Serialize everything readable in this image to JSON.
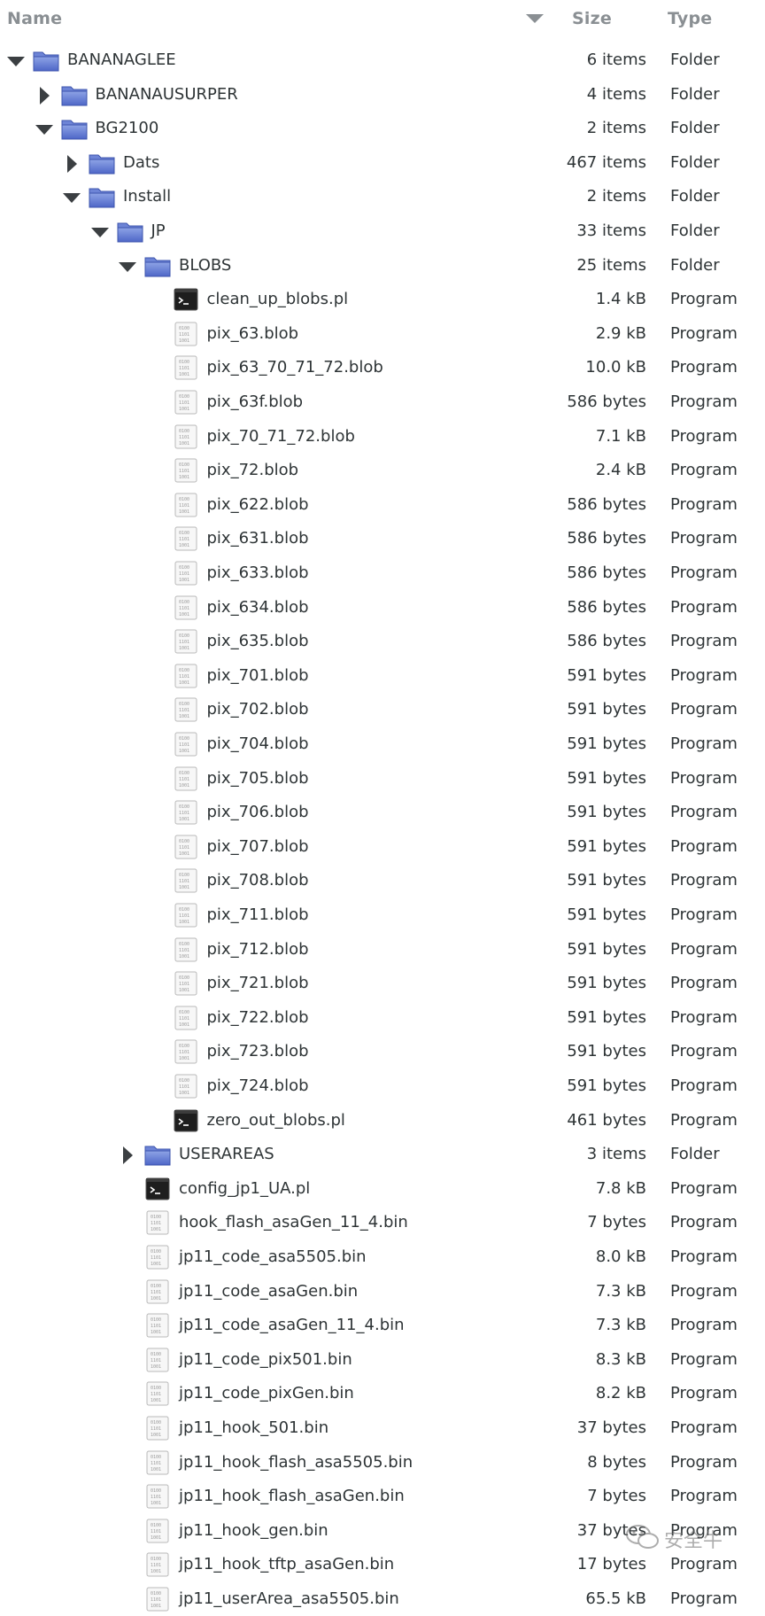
{
  "header": {
    "name_label": "Name",
    "size_label": "Size",
    "type_label": "Type",
    "sort_icon": "sort-descending-icon"
  },
  "rows": [
    {
      "name": "BANANAGLEE",
      "size": "6 items",
      "type": "Folder",
      "depth": 0,
      "kind": "folder",
      "expander": "open"
    },
    {
      "name": "BANANAUSURPER",
      "size": "4 items",
      "type": "Folder",
      "depth": 1,
      "kind": "folder",
      "expander": "closed"
    },
    {
      "name": "BG2100",
      "size": "2 items",
      "type": "Folder",
      "depth": 1,
      "kind": "folder",
      "expander": "open"
    },
    {
      "name": "Dats",
      "size": "467 items",
      "type": "Folder",
      "depth": 2,
      "kind": "folder",
      "expander": "closed"
    },
    {
      "name": "Install",
      "size": "2 items",
      "type": "Folder",
      "depth": 2,
      "kind": "folder",
      "expander": "open"
    },
    {
      "name": "JP",
      "size": "33 items",
      "type": "Folder",
      "depth": 3,
      "kind": "folder",
      "expander": "open"
    },
    {
      "name": "BLOBS",
      "size": "25 items",
      "type": "Folder",
      "depth": 4,
      "kind": "folder",
      "expander": "open"
    },
    {
      "name": "clean_up_blobs.pl",
      "size": "1.4 kB",
      "type": "Program",
      "depth": 5,
      "kind": "script"
    },
    {
      "name": "pix_63.blob",
      "size": "2.9 kB",
      "type": "Program",
      "depth": 5,
      "kind": "binary"
    },
    {
      "name": "pix_63_70_71_72.blob",
      "size": "10.0 kB",
      "type": "Program",
      "depth": 5,
      "kind": "binary"
    },
    {
      "name": "pix_63f.blob",
      "size": "586 bytes",
      "type": "Program",
      "depth": 5,
      "kind": "binary"
    },
    {
      "name": "pix_70_71_72.blob",
      "size": "7.1 kB",
      "type": "Program",
      "depth": 5,
      "kind": "binary"
    },
    {
      "name": "pix_72.blob",
      "size": "2.4 kB",
      "type": "Program",
      "depth": 5,
      "kind": "binary"
    },
    {
      "name": "pix_622.blob",
      "size": "586 bytes",
      "type": "Program",
      "depth": 5,
      "kind": "binary"
    },
    {
      "name": "pix_631.blob",
      "size": "586 bytes",
      "type": "Program",
      "depth": 5,
      "kind": "binary"
    },
    {
      "name": "pix_633.blob",
      "size": "586 bytes",
      "type": "Program",
      "depth": 5,
      "kind": "binary"
    },
    {
      "name": "pix_634.blob",
      "size": "586 bytes",
      "type": "Program",
      "depth": 5,
      "kind": "binary"
    },
    {
      "name": "pix_635.blob",
      "size": "586 bytes",
      "type": "Program",
      "depth": 5,
      "kind": "binary"
    },
    {
      "name": "pix_701.blob",
      "size": "591 bytes",
      "type": "Program",
      "depth": 5,
      "kind": "binary"
    },
    {
      "name": "pix_702.blob",
      "size": "591 bytes",
      "type": "Program",
      "depth": 5,
      "kind": "binary"
    },
    {
      "name": "pix_704.blob",
      "size": "591 bytes",
      "type": "Program",
      "depth": 5,
      "kind": "binary"
    },
    {
      "name": "pix_705.blob",
      "size": "591 bytes",
      "type": "Program",
      "depth": 5,
      "kind": "binary"
    },
    {
      "name": "pix_706.blob",
      "size": "591 bytes",
      "type": "Program",
      "depth": 5,
      "kind": "binary"
    },
    {
      "name": "pix_707.blob",
      "size": "591 bytes",
      "type": "Program",
      "depth": 5,
      "kind": "binary"
    },
    {
      "name": "pix_708.blob",
      "size": "591 bytes",
      "type": "Program",
      "depth": 5,
      "kind": "binary"
    },
    {
      "name": "pix_711.blob",
      "size": "591 bytes",
      "type": "Program",
      "depth": 5,
      "kind": "binary"
    },
    {
      "name": "pix_712.blob",
      "size": "591 bytes",
      "type": "Program",
      "depth": 5,
      "kind": "binary"
    },
    {
      "name": "pix_721.blob",
      "size": "591 bytes",
      "type": "Program",
      "depth": 5,
      "kind": "binary"
    },
    {
      "name": "pix_722.blob",
      "size": "591 bytes",
      "type": "Program",
      "depth": 5,
      "kind": "binary"
    },
    {
      "name": "pix_723.blob",
      "size": "591 bytes",
      "type": "Program",
      "depth": 5,
      "kind": "binary"
    },
    {
      "name": "pix_724.blob",
      "size": "591 bytes",
      "type": "Program",
      "depth": 5,
      "kind": "binary"
    },
    {
      "name": "zero_out_blobs.pl",
      "size": "461 bytes",
      "type": "Program",
      "depth": 5,
      "kind": "script"
    },
    {
      "name": "USERAREAS",
      "size": "3 items",
      "type": "Folder",
      "depth": 4,
      "kind": "folder",
      "expander": "closed"
    },
    {
      "name": "config_jp1_UA.pl",
      "size": "7.8 kB",
      "type": "Program",
      "depth": 4,
      "kind": "script"
    },
    {
      "name": "hook_flash_asaGen_11_4.bin",
      "size": "7 bytes",
      "type": "Program",
      "depth": 4,
      "kind": "binary"
    },
    {
      "name": "jp11_code_asa5505.bin",
      "size": "8.0 kB",
      "type": "Program",
      "depth": 4,
      "kind": "binary"
    },
    {
      "name": "jp11_code_asaGen.bin",
      "size": "7.3 kB",
      "type": "Program",
      "depth": 4,
      "kind": "binary"
    },
    {
      "name": "jp11_code_asaGen_11_4.bin",
      "size": "7.3 kB",
      "type": "Program",
      "depth": 4,
      "kind": "binary"
    },
    {
      "name": "jp11_code_pix501.bin",
      "size": "8.3 kB",
      "type": "Program",
      "depth": 4,
      "kind": "binary"
    },
    {
      "name": "jp11_code_pixGen.bin",
      "size": "8.2 kB",
      "type": "Program",
      "depth": 4,
      "kind": "binary"
    },
    {
      "name": "jp11_hook_501.bin",
      "size": "37 bytes",
      "type": "Program",
      "depth": 4,
      "kind": "binary"
    },
    {
      "name": "jp11_hook_flash_asa5505.bin",
      "size": "8 bytes",
      "type": "Program",
      "depth": 4,
      "kind": "binary"
    },
    {
      "name": "jp11_hook_flash_asaGen.bin",
      "size": "7 bytes",
      "type": "Program",
      "depth": 4,
      "kind": "binary"
    },
    {
      "name": "jp11_hook_gen.bin",
      "size": "37 bytes",
      "type": "Program",
      "depth": 4,
      "kind": "binary"
    },
    {
      "name": "jp11_hook_tftp_asaGen.bin",
      "size": "17 bytes",
      "type": "Program",
      "depth": 4,
      "kind": "binary"
    },
    {
      "name": "jp11_userArea_asa5505.bin",
      "size": "65.5 kB",
      "type": "Program",
      "depth": 4,
      "kind": "binary"
    }
  ],
  "watermark": {
    "text": "安全牛",
    "icon": "wechat-icon"
  }
}
